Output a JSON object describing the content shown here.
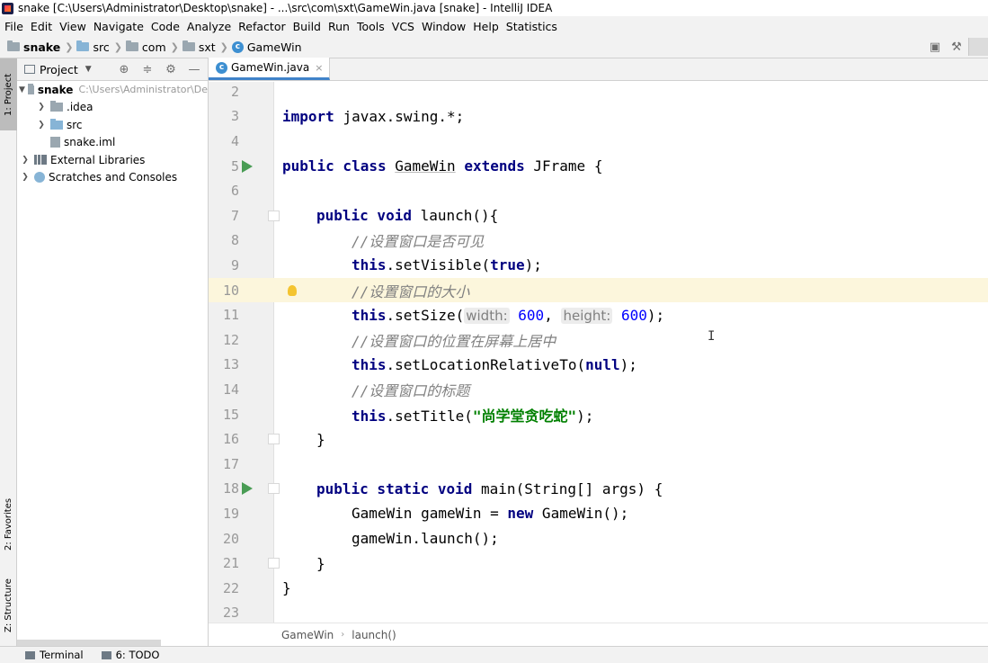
{
  "window": {
    "title": "snake [C:\\Users\\Administrator\\Desktop\\snake] - ...\\src\\com\\sxt\\GameWin.java [snake] - IntelliJ IDEA"
  },
  "menu": [
    "File",
    "Edit",
    "View",
    "Navigate",
    "Code",
    "Analyze",
    "Refactor",
    "Build",
    "Run",
    "Tools",
    "VCS",
    "Window",
    "Help",
    "Statistics"
  ],
  "breadcrumb": [
    "snake",
    "src",
    "com",
    "sxt",
    "GameWin"
  ],
  "left_strip": {
    "project": "1: Project",
    "favorites": "2: Favorites",
    "structure": "Z: Structure"
  },
  "project_panel": {
    "title": "Project",
    "tree": [
      {
        "label": "snake",
        "path": "C:\\Users\\Administrator\\De"
      },
      {
        "label": ".idea"
      },
      {
        "label": "src"
      },
      {
        "label": "snake.iml"
      },
      {
        "label": "External Libraries"
      },
      {
        "label": "Scratches and Consoles"
      }
    ]
  },
  "editor": {
    "tab": "GameWin.java",
    "lines": [
      {
        "num": "2"
      },
      {
        "num": "3",
        "tokens": [
          "import",
          "javax.swing.*;"
        ]
      },
      {
        "num": "4"
      },
      {
        "num": "5",
        "tokens": [
          "public class",
          "GameWin",
          "extends",
          "JFrame {"
        ]
      },
      {
        "num": "6"
      },
      {
        "num": "7",
        "tokens": [
          "public void",
          "launch(){"
        ]
      },
      {
        "num": "8",
        "tokens": [
          "//设置窗口是否可见"
        ]
      },
      {
        "num": "9",
        "tokens": [
          "this",
          ".setVisible(",
          "true",
          ");"
        ]
      },
      {
        "num": "10",
        "tokens": [
          "//设置窗口的大小"
        ]
      },
      {
        "num": "11",
        "tokens": [
          "this",
          ".setSize(",
          "width:",
          "600",
          ",",
          "height:",
          "600",
          ");"
        ]
      },
      {
        "num": "12",
        "tokens": [
          "//设置窗口的位置在屏幕上居中"
        ]
      },
      {
        "num": "13",
        "tokens": [
          "this",
          ".setLocationRelativeTo(",
          "null",
          ");"
        ]
      },
      {
        "num": "14",
        "tokens": [
          "//设置窗口的标题"
        ]
      },
      {
        "num": "15",
        "tokens": [
          "this",
          ".setTitle(",
          "\"尚学堂贪吃蛇\"",
          ");"
        ]
      },
      {
        "num": "16",
        "tokens": [
          "}"
        ]
      },
      {
        "num": "17"
      },
      {
        "num": "18",
        "tokens": [
          "public static void",
          "main(String[] args) {"
        ]
      },
      {
        "num": "19",
        "tokens": [
          "GameWin gameWin = ",
          "new",
          " GameWin();"
        ]
      },
      {
        "num": "20",
        "tokens": [
          "gameWin.launch();"
        ]
      },
      {
        "num": "21",
        "tokens": [
          "}"
        ]
      },
      {
        "num": "22",
        "tokens": [
          "}"
        ]
      },
      {
        "num": "23"
      }
    ],
    "breadcrumb": [
      "GameWin",
      "launch()"
    ]
  },
  "bottom_tools": [
    "Terminal",
    "6: TODO"
  ],
  "colors": {
    "keyword": "#000080",
    "comment": "#808080",
    "number": "#0000ff",
    "string": "#008000",
    "caret_line": "#fcf6dc",
    "run": "#499c54",
    "tab_underline": "#4083c9"
  }
}
